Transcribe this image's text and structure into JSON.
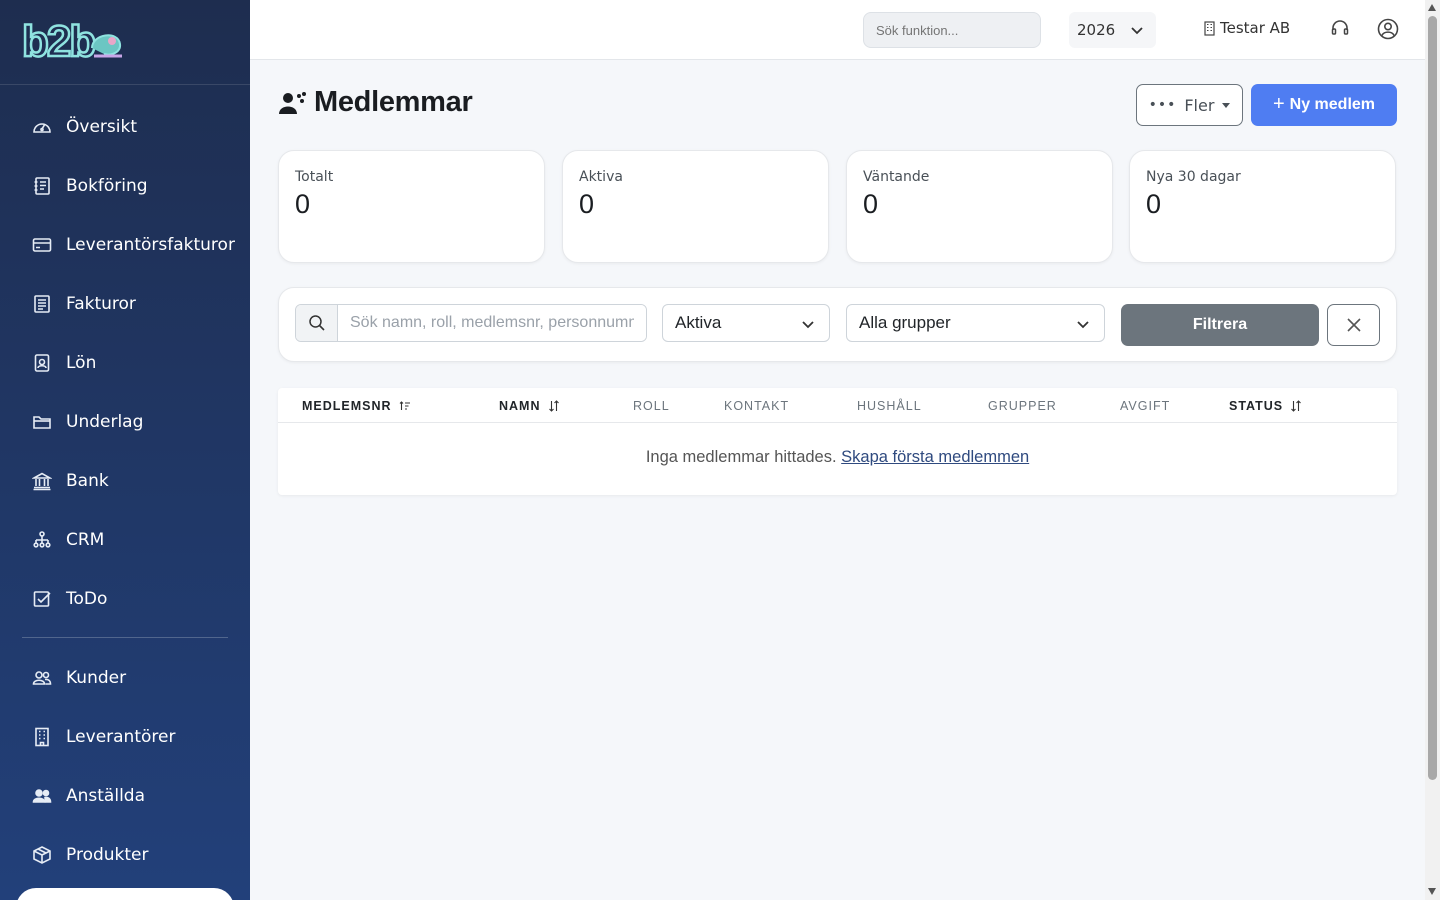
{
  "brand": {
    "logo_text": "b2b"
  },
  "sidebar": {
    "items": [
      {
        "label": "Översikt",
        "icon": "speedometer-icon"
      },
      {
        "label": "Bokföring",
        "icon": "journal-icon"
      },
      {
        "label": "Leverantörsfakturor",
        "icon": "credit-card-icon"
      },
      {
        "label": "Fakturor",
        "icon": "invoice-icon"
      },
      {
        "label": "Lön",
        "icon": "badge-icon"
      },
      {
        "label": "Underlag",
        "icon": "folder-icon"
      },
      {
        "label": "Bank",
        "icon": "bank-icon"
      },
      {
        "label": "CRM",
        "icon": "diagram-icon"
      },
      {
        "label": "ToDo",
        "icon": "checkbox-icon"
      }
    ],
    "items2": [
      {
        "label": "Kunder",
        "icon": "people-icon"
      },
      {
        "label": "Leverantörer",
        "icon": "building-icon"
      },
      {
        "label": "Anställda",
        "icon": "people-fill-icon"
      },
      {
        "label": "Produkter",
        "icon": "box-icon"
      }
    ]
  },
  "topbar": {
    "search_placeholder": "Sök funktion...",
    "year": "2026",
    "company": "Testar AB"
  },
  "page": {
    "title": "Medlemmar",
    "more_label": "Fler",
    "new_label": "Ny medlem"
  },
  "stats": [
    {
      "label": "Totalt",
      "value": "0"
    },
    {
      "label": "Aktiva",
      "value": "0"
    },
    {
      "label": "Väntande",
      "value": "0"
    },
    {
      "label": "Nya 30 dagar",
      "value": "0"
    }
  ],
  "filters": {
    "search_placeholder": "Sök namn, roll, medlemsnr, personnummer",
    "status_value": "Aktiva",
    "group_value": "Alla grupper",
    "filter_label": "Filtrera"
  },
  "table": {
    "columns": [
      {
        "label": "MEDLEMSNR",
        "sortable": true
      },
      {
        "label": "NAMN",
        "sortable": true
      },
      {
        "label": "ROLL",
        "sortable": false
      },
      {
        "label": "KONTAKT",
        "sortable": false
      },
      {
        "label": "HUSHÅLL",
        "sortable": false
      },
      {
        "label": "GRUPPER",
        "sortable": false
      },
      {
        "label": "AVGIFT",
        "sortable": false
      },
      {
        "label": "STATUS",
        "sortable": true
      }
    ],
    "empty_text": "Inga medlemmar hittades.",
    "empty_link": "Skapa första medlemmen"
  },
  "colors": {
    "sidebar_top": "#1e2d4f",
    "sidebar_bottom": "#22407a",
    "primary": "#4f7df2",
    "secondary": "#6c757d"
  }
}
